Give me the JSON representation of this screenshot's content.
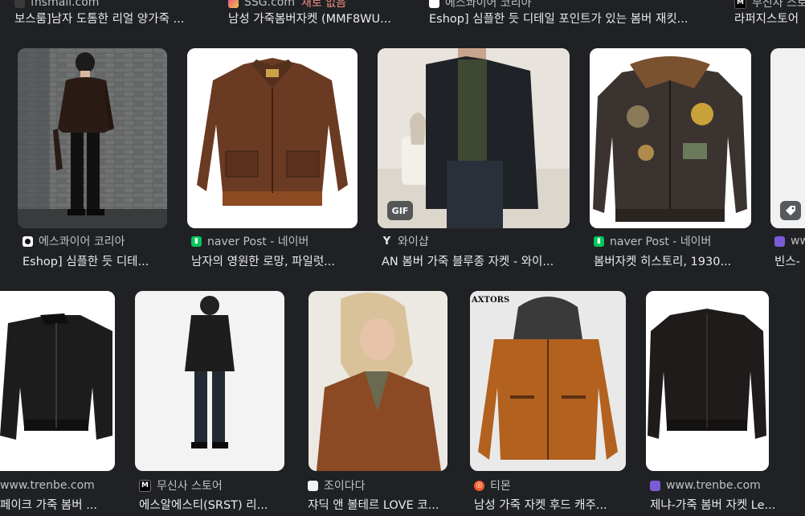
{
  "top_row": [
    {
      "source": "fnsmall.com",
      "title": "보스룸]남자 도톰한 리얼 양가죽 ..."
    },
    {
      "source": "SSG.com",
      "ad": "새로 없음",
      "title": "남성 가죽봄버자켓 (MMF8WU..."
    },
    {
      "source": "에스콰이어 코리아",
      "title": "Eshop] 심플한 듯 디테일 포인트가 있는 봄버 재킷..."
    },
    {
      "source": "무신사 스토어",
      "title": "라퍼지스토어"
    }
  ],
  "row1": [
    {
      "source": "에스콰이어 코리아",
      "title": "Eshop] 심플한 듯 디테...",
      "favicon": "esquire-icon",
      "color": "#ffffff"
    },
    {
      "source": "naver Post - 네이버",
      "title": "남자의 영원한 로망, 파일럿...",
      "favicon": "naver-icon",
      "color": "#03c75a"
    },
    {
      "source": "와이샵",
      "title": "AN 봄버 가죽 블루종 자켓 - 와이...",
      "favicon": "yshop-icon",
      "color": "#202124",
      "badge": "GIF"
    },
    {
      "source": "naver Post - 네이버",
      "title": "봄버자켓 히스토리, 1930...",
      "favicon": "naver-icon",
      "color": "#03c75a"
    },
    {
      "source": "www.trenbe.com",
      "title": "빈스-",
      "favicon": "trenbe-icon",
      "color": "#7b5cd6"
    }
  ],
  "row2": [
    {
      "source": "www.trenbe.com",
      "title": "페이크 가죽 봄버 ..."
    },
    {
      "source": "무신사 스토어",
      "title": "에스알에스티(SRST) 리...",
      "favicon": "musinsa-icon"
    },
    {
      "source": "조이다다",
      "title": "쟈딕 앤 볼테르 LOVE 코...",
      "favicon": "joydada-icon"
    },
    {
      "source": "티몬",
      "title": "남성 가죽 자켓 후드 캐주...",
      "favicon": "tmon-icon"
    },
    {
      "source": "www.trenbe.com",
      "title": "제냐-가죽 봄버 자켓 Le...",
      "favicon": "trenbe-icon"
    }
  ],
  "logo_text": "AXTORS"
}
